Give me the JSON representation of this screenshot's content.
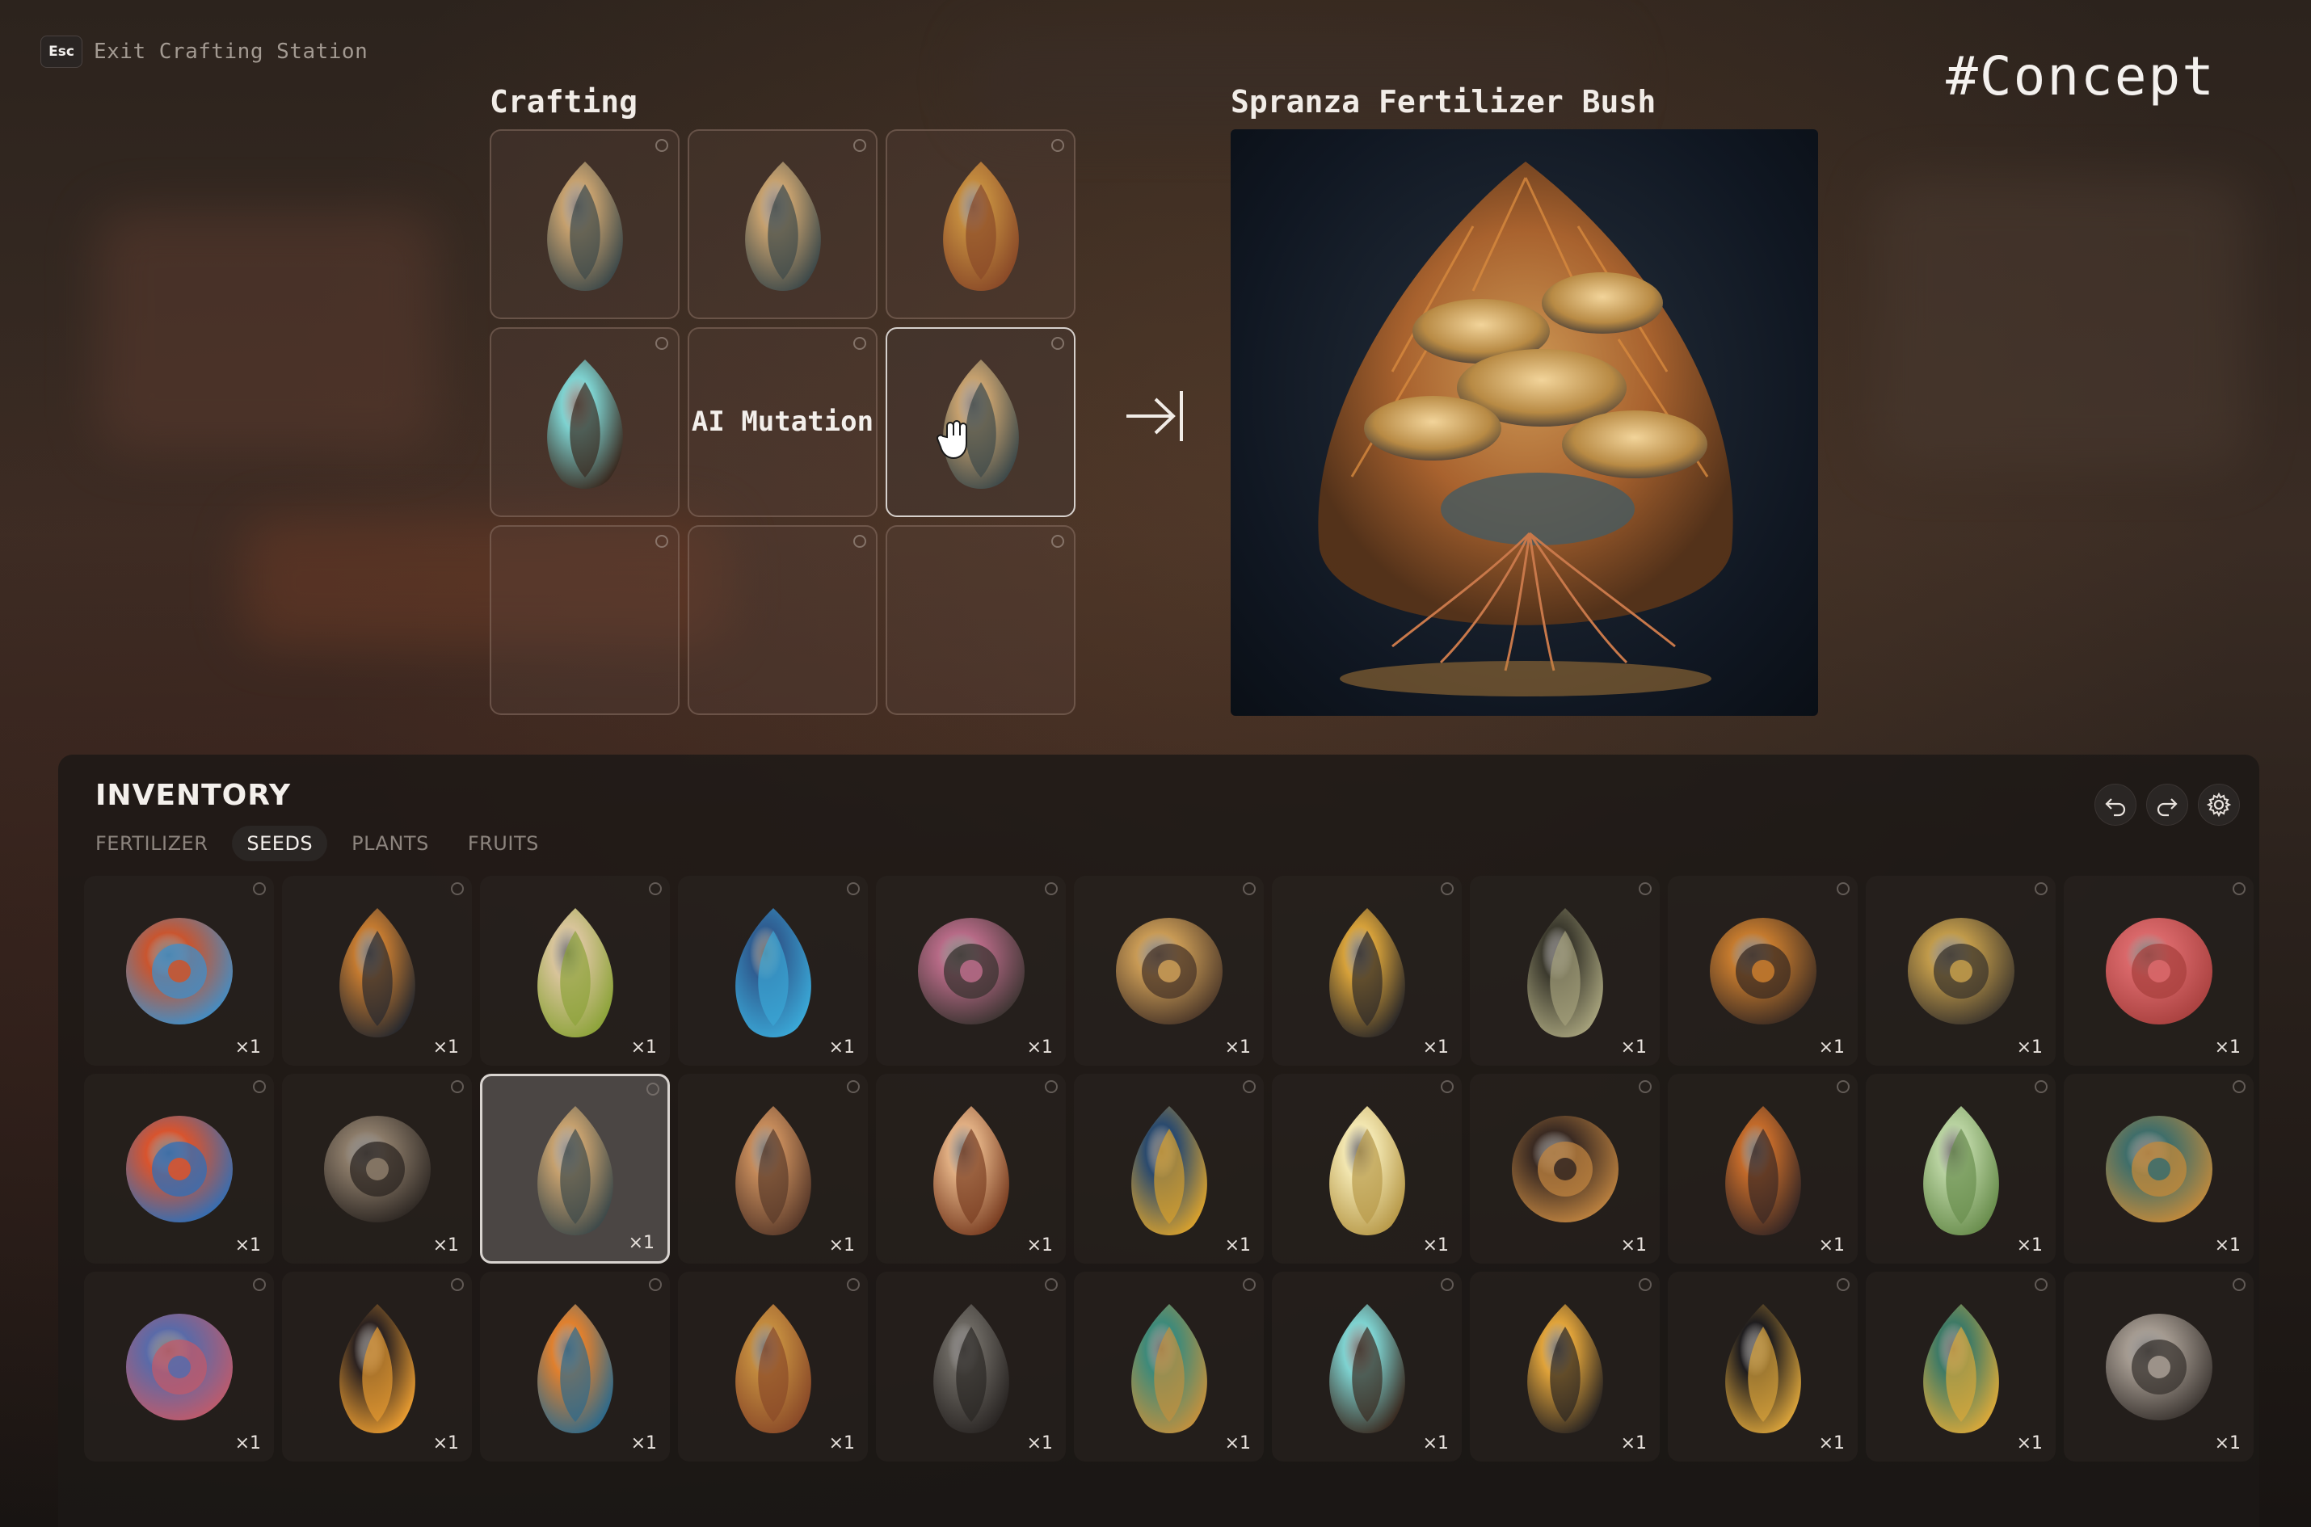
{
  "header": {
    "esc_key": "Esc",
    "exit_label": "Exit Crafting Station",
    "concept_tag": "#Concept"
  },
  "crafting": {
    "title": "Crafting",
    "slots": [
      {
        "icon": "tulip-seed-icon",
        "filled": true
      },
      {
        "icon": "tulip-seed-icon",
        "filled": true
      },
      {
        "icon": "split-pod-seed-icon",
        "filled": true
      },
      {
        "icon": "turquoise-pod-seed-icon",
        "filled": true
      },
      {
        "icon": "mutation-slot",
        "label": "AI Mutation",
        "filled": true
      },
      {
        "icon": "tulip-seed-icon",
        "filled": true,
        "active": true
      },
      {
        "filled": false
      },
      {
        "filled": false
      },
      {
        "filled": false
      }
    ],
    "cursor_icon": "hand-cursor-icon",
    "arrow_icon": "craft-arrow-icon"
  },
  "result": {
    "title": "Spranza Fertilizer Bush",
    "image_icon": "fertilizer-bush-image"
  },
  "inventory": {
    "title": "INVENTORY",
    "tabs": [
      {
        "label": "FERTILIZER",
        "selected": false
      },
      {
        "label": "SEEDS",
        "selected": true
      },
      {
        "label": "PLANTS",
        "selected": false
      },
      {
        "label": "FRUITS",
        "selected": false
      }
    ],
    "tools": [
      "undo-icon",
      "redo-icon",
      "settings-icon"
    ],
    "items": [
      {
        "icon": "rainbow-spiral-seed-icon",
        "qty": "×1",
        "c1": "#c9552f",
        "c2": "#3f8fc9"
      },
      {
        "icon": "amber-glass-seed-icon",
        "qty": "×1",
        "c1": "#c37a30",
        "c2": "#2a2a2e"
      },
      {
        "icon": "cream-flower-seed-icon",
        "qty": "×1",
        "c1": "#d8c49a",
        "c2": "#8da33a"
      },
      {
        "icon": "blue-petal-seed-icon",
        "qty": "×1",
        "c1": "#2f5e92",
        "c2": "#3aa7d6"
      },
      {
        "icon": "honeycomb-pink-seed-icon",
        "qty": "×1",
        "c1": "#b66a86",
        "c2": "#3a3330"
      },
      {
        "icon": "sunflower-disc-seed-icon",
        "qty": "×1",
        "c1": "#c89a55",
        "c2": "#4a3628"
      },
      {
        "icon": "gold-speckled-seed-icon",
        "qty": "×1",
        "c1": "#d6a13a",
        "c2": "#2e2a28"
      },
      {
        "icon": "dark-leaf-seed-icon",
        "qty": "×1",
        "c1": "#3c3a2e",
        "c2": "#a4a07a"
      },
      {
        "icon": "hex-amber-seed-icon",
        "qty": "×1",
        "c1": "#c47a2e",
        "c2": "#3b2b22"
      },
      {
        "icon": "golden-burst-seed-icon",
        "qty": "×1",
        "c1": "#c09a4a",
        "c2": "#3c352c"
      },
      {
        "icon": "coral-branch-icon",
        "qty": "×1",
        "c1": "#d9686a",
        "c2": "#a8403e"
      },
      {
        "icon": "rainbow-fan-seed-icon",
        "qty": "×1",
        "c1": "#d8542e",
        "c2": "#2f6fb8"
      },
      {
        "icon": "spiky-urchin-seed-icon",
        "qty": "×1",
        "c1": "#8a7a68",
        "c2": "#2c2622"
      },
      {
        "icon": "tulip-seed-icon",
        "qty": "×1",
        "c1": "#c5a06e",
        "c2": "#3f4a4a",
        "selected": true
      },
      {
        "icon": "star-pattern-seed-icon",
        "qty": "×1",
        "c1": "#c48a5a",
        "c2": "#5a3a2a"
      },
      {
        "icon": "open-pod-seed-icon",
        "qty": "×1",
        "c1": "#e0ae82",
        "c2": "#7a3e22"
      },
      {
        "icon": "blue-gold-seed-icon",
        "qty": "×1",
        "c1": "#2a4a6e",
        "c2": "#d6a02e"
      },
      {
        "icon": "glowing-leaf-seed-icon",
        "qty": "×1",
        "c1": "#f2e6b0",
        "c2": "#b89a4a"
      },
      {
        "icon": "dark-spiky-seed-icon",
        "qty": "×1",
        "c1": "#3a2a22",
        "c2": "#c08440"
      },
      {
        "icon": "veined-leaf-seed-icon",
        "qty": "×1",
        "c1": "#c26a2a",
        "c2": "#3a2824"
      },
      {
        "icon": "green-bead-seed-icon",
        "qty": "×1",
        "c1": "#b8d2a0",
        "c2": "#6a8e4e"
      },
      {
        "icon": "teal-frill-seed-icon",
        "qty": "×1",
        "c1": "#3f6e6a",
        "c2": "#c48a3a"
      },
      {
        "icon": "speckled-heart-seed-icon",
        "qty": "×1",
        "c1": "#5a6aa8",
        "c2": "#c05a6a"
      },
      {
        "icon": "flame-drop-seed-icon",
        "qty": "×1",
        "c1": "#2c2220",
        "c2": "#e69a30"
      },
      {
        "icon": "orange-flame-seed-icon",
        "qty": "×1",
        "c1": "#e0802e",
        "c2": "#2f6a8a"
      },
      {
        "icon": "split-pod-seed-icon",
        "qty": "×1",
        "c1": "#c28a3e",
        "c2": "#8a4a28"
      },
      {
        "icon": "grey-honeycomb-seed-icon",
        "qty": "×1",
        "c1": "#6a6660",
        "c2": "#2a2624"
      },
      {
        "icon": "teal-fern-seed-icon",
        "qty": "×1",
        "c1": "#3e8a7a",
        "c2": "#c0903e"
      },
      {
        "icon": "turquoise-pod-seed-icon",
        "qty": "×1",
        "c1": "#7ed2d0",
        "c2": "#3a2c22"
      },
      {
        "icon": "gold-hex-seed-icon",
        "qty": "×1",
        "c1": "#e0a33a",
        "c2": "#2c2622"
      },
      {
        "icon": "black-gold-seed-icon",
        "qty": "×1",
        "c1": "#1e1c1e",
        "c2": "#d8a23a"
      },
      {
        "icon": "emerald-bead-seed-icon",
        "qty": "×1",
        "c1": "#3e7a66",
        "c2": "#d8a83a"
      },
      {
        "icon": "grey-urchin-seed-icon",
        "qty": "×1",
        "c1": "#a49a90",
        "c2": "#3a3430"
      }
    ]
  },
  "colors": {
    "background": "#2c231d",
    "panel": "#1c1816",
    "accent_text": "#f4f0ec",
    "muted_text": "#8c847e"
  }
}
